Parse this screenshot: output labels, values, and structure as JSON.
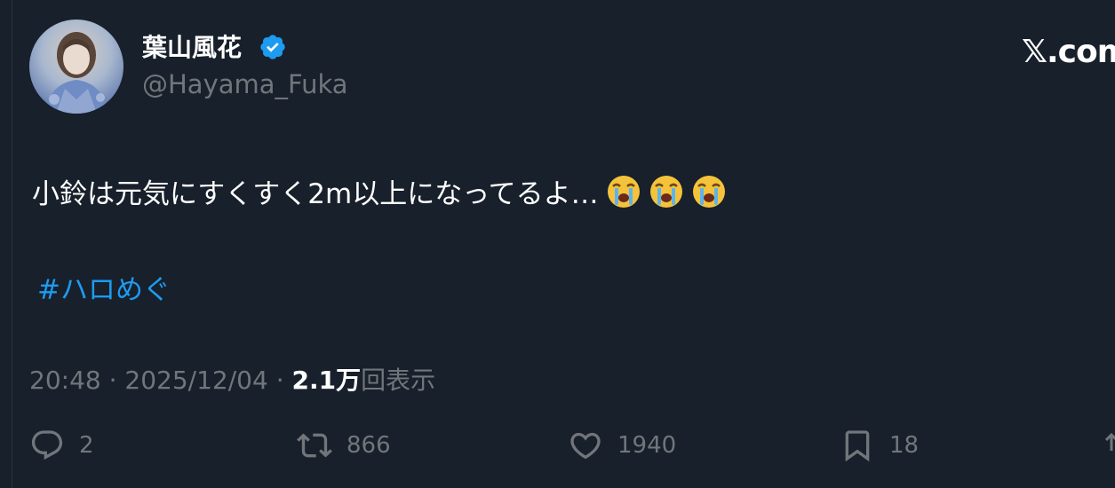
{
  "author": {
    "display_name": "葉山風花",
    "handle": "@Hayama_Fuka",
    "verified": true
  },
  "site_label": "𝕏.com",
  "tweet": {
    "text": "小鈴は元気にすくすく2m以上になってるよ…",
    "emojis": [
      "loudly-crying-face",
      "loudly-crying-face",
      "loudly-crying-face"
    ],
    "hashtag": "#ハロめぐ"
  },
  "meta": {
    "time": "20:48",
    "sep1": " · ",
    "date": "2025/12/04",
    "sep2": " · ",
    "views": "2.1万",
    "views_label": "回表示"
  },
  "actions": {
    "replies": "2",
    "retweets": "866",
    "likes": "1940",
    "bookmarks": "18"
  },
  "colors": {
    "background": "#18202b",
    "link": "#1d9bf0",
    "muted": "#71767b",
    "verified": "#1d9bf0"
  }
}
